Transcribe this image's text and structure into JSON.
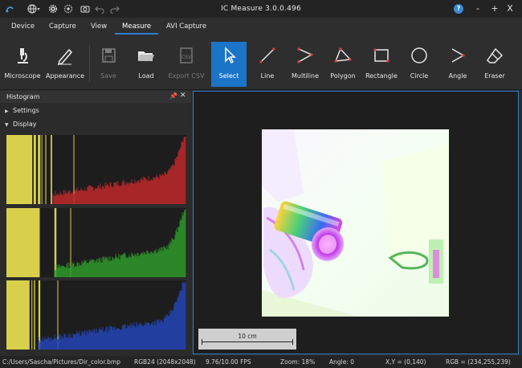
{
  "window": {
    "title": "IC Measure 3.0.0.496",
    "help_label": "?",
    "min_label": "-",
    "max_label": "+",
    "close_label": "X"
  },
  "menu": {
    "tabs": [
      {
        "label": "Device"
      },
      {
        "label": "Capture"
      },
      {
        "label": "View"
      },
      {
        "label": "Measure"
      },
      {
        "label": "AVI Capture"
      }
    ],
    "active": "Measure"
  },
  "toolbar": {
    "buttons": [
      {
        "label": "Microscope",
        "icon": "microscope-icon",
        "state": "normal"
      },
      {
        "label": "Appearance",
        "icon": "pencil-icon",
        "state": "normal"
      },
      {
        "label": "Save",
        "icon": "save-icon",
        "state": "disabled"
      },
      {
        "label": "Load",
        "icon": "folder-open-icon",
        "state": "normal"
      },
      {
        "label": "Export CSV",
        "icon": "csv-icon",
        "state": "disabled"
      },
      {
        "label": "Select",
        "icon": "cursor-icon",
        "state": "selected"
      },
      {
        "label": "Line",
        "icon": "line-icon",
        "state": "normal"
      },
      {
        "label": "Multiline",
        "icon": "multiline-icon",
        "state": "normal"
      },
      {
        "label": "Polygon",
        "icon": "polygon-icon",
        "state": "normal"
      },
      {
        "label": "Rectangle",
        "icon": "rectangle-icon",
        "state": "normal"
      },
      {
        "label": "Circle",
        "icon": "circle-icon",
        "state": "normal"
      },
      {
        "label": "Angle",
        "icon": "angle-icon",
        "state": "normal"
      },
      {
        "label": "Eraser",
        "icon": "eraser-icon",
        "state": "normal"
      }
    ]
  },
  "histogram_panel": {
    "title": "Histogram",
    "settings_label": "Settings",
    "display_label": "Display",
    "channels": [
      "red",
      "green",
      "blue"
    ]
  },
  "viewer": {
    "scale_bar_label": "10 cm"
  },
  "status": {
    "path": "C:/Users/Sascha/Pictures/Dir_color.bmp",
    "format": "RGB24 (2048x2048)",
    "fps": "9.76/10.00 FPS",
    "zoom": "Zoom: 18%",
    "angle": "Angle: 0",
    "coords": "X,Y = (0,140)",
    "rgb": "RGB = (234,255,239)"
  },
  "colors": {
    "accent": "#1c74c8",
    "viewer_border": "#2d7fd0",
    "histogram_yellow": "#d8d04a",
    "histogram_red": "#c0282a",
    "histogram_green": "#2e9a2a",
    "histogram_blue": "#2446b8"
  }
}
